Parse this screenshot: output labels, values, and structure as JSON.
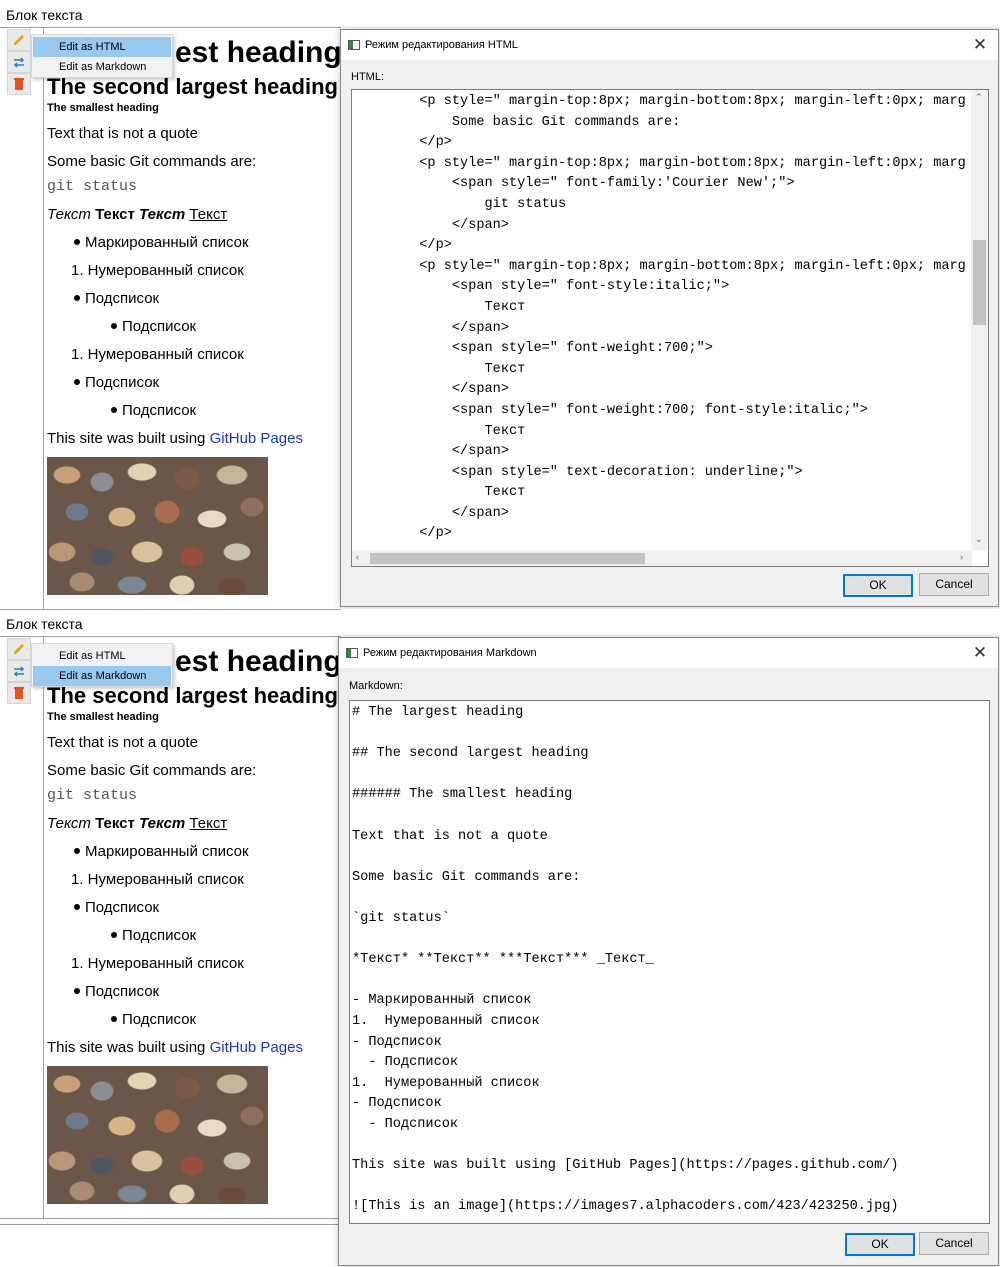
{
  "block_title": "Блок текста",
  "menu": {
    "edit_html": "Edit as HTML",
    "edit_markdown": "Edit as Markdown"
  },
  "content": {
    "h1_partial": "est heading",
    "h2": "The second largest heading",
    "h6": "The smallest heading",
    "quote_text": "Text that is not a quote",
    "git_intro": "Some basic Git commands are:",
    "git_code": "git status",
    "italic": "Текст",
    "bold": "Текст",
    "bold_italic": "Текст",
    "underline": "Текст",
    "list_bulleted": "Маркированный список",
    "list_numbered": "1. Нумерованный список",
    "sublist": "Подсписок",
    "site_prefix": "This site was built using ",
    "site_link": "GitHub Pages"
  },
  "html_dialog": {
    "title": "Режим редактирования HTML",
    "label": "HTML:",
    "lines": [
      "        <p style=\" margin-top:8px; margin-bottom:8px; margin-left:0px; marg",
      "            Some basic Git commands are:",
      "        </p>",
      "        <p style=\" margin-top:8px; margin-bottom:8px; margin-left:0px; marg",
      "            <span style=\" font-family:'Courier New';\">",
      "                git status",
      "            </span>",
      "        </p>",
      "        <p style=\" margin-top:8px; margin-bottom:8px; margin-left:0px; marg",
      "            <span style=\" font-style:italic;\">",
      "                Текст",
      "            </span>",
      "            <span style=\" font-weight:700;\">",
      "                Текст",
      "            </span>",
      "            <span style=\" font-weight:700; font-style:italic;\">",
      "                Текст",
      "            </span>",
      "            <span style=\" text-decoration: underline;\">",
      "                Текст",
      "            </span>",
      "        </p>"
    ],
    "ok": "OK",
    "cancel": "Cancel"
  },
  "md_dialog": {
    "title": "Режим редактирования Markdown",
    "label": "Markdown:",
    "lines": [
      "# The largest heading",
      "",
      "## The second largest heading",
      "",
      "###### The smallest heading",
      "",
      "Text that is not a quote",
      "",
      "Some basic Git commands are:",
      "",
      "`git status`",
      "",
      "*Текст* **Текст** ***Текст*** _Текст_",
      "",
      "- Маркированный список",
      "1.  Нумерованный список",
      "- Подсписок",
      "  - Подсписок",
      "1.  Нумерованный список",
      "- Подсписок",
      "  - Подсписок",
      "",
      "This site was built using [GitHub Pages](https://pages.github.com/)",
      "",
      "![This is an image](https://images7.alphacoders.com/423/423250.jpg)"
    ],
    "ok": "OK",
    "cancel": "Cancel"
  }
}
